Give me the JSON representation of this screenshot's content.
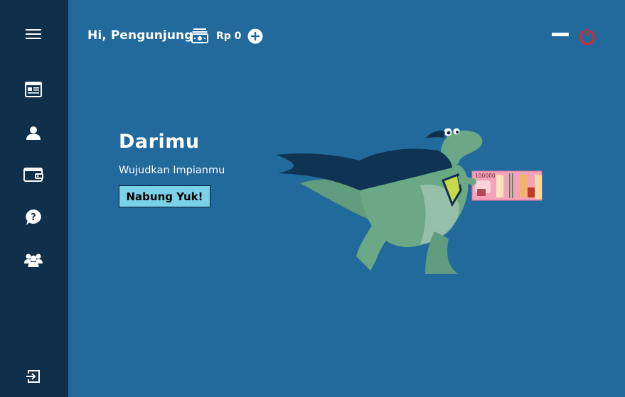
{
  "header": {
    "greeting": "Hi, Pengunjung",
    "balance": "Rp 0"
  },
  "sidebar": {
    "items": [
      {
        "icon": "menu-icon"
      },
      {
        "icon": "dashboard-icon"
      },
      {
        "icon": "user-icon"
      },
      {
        "icon": "wallet-icon"
      },
      {
        "icon": "help-icon"
      },
      {
        "icon": "group-icon"
      },
      {
        "icon": "logout-icon"
      }
    ]
  },
  "hero": {
    "title": "Darimu",
    "subtitle": "Wujudkan Impianmu",
    "cta_label": "Nabung Yuk!",
    "banknote_text": "100000"
  },
  "colors": {
    "background": "#236a9c",
    "sidebar": "#102f4b",
    "cta": "#7bd2e8",
    "power": "#e0262d"
  }
}
